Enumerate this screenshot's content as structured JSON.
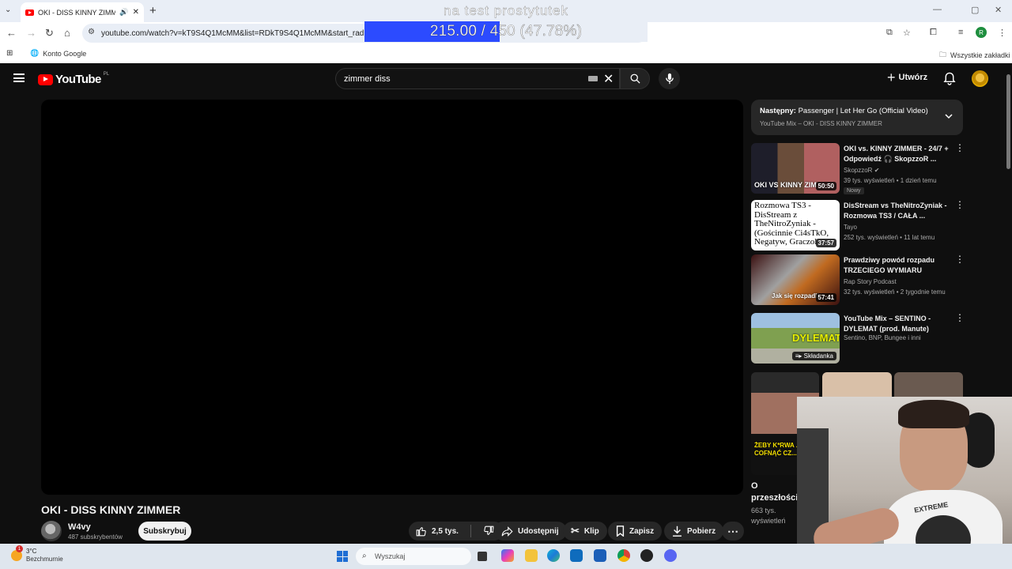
{
  "browser": {
    "tab_title": "OKI - DISS KINNY ZIMMER",
    "url": "youtube.com/watch?v=kT9S4Q1McMM&list=RDkT9S4Q1McMM&start_radio=1",
    "bookmark_google": "Konto Google",
    "bookmark_all": "Wszystkie zakładki",
    "profile_initial": "R"
  },
  "overlay": {
    "top_text": "na test prostytutek",
    "progress_text": "215.00 / 450 (47.78%)",
    "progress_fraction": 0.4778,
    "fill_color": "#2c4bff"
  },
  "youtube": {
    "logo_text": "YouTube",
    "region": "PL",
    "search_value": "zimmer diss",
    "create_label": "Utwórz",
    "video_title": "OKI - DISS KINNY ZIMMER",
    "channel_name": "W4vy",
    "channel_subs": "487 subskrybentów",
    "subscribe_label": "Subskrybuj",
    "likes": "2,5 tys.",
    "share_label": "Udostępnij",
    "clip_label": "Klip",
    "save_label": "Zapisz",
    "download_label": "Pobierz",
    "up_next_prefix": "Następny:",
    "up_next_title": "Passenger | Let Her Go (Official Video)",
    "up_next_sub": "YouTube Mix – OKI - DISS KINNY ZIMMER",
    "recommendations": [
      {
        "title": "OKI vs. KINNY ZIMMER - 24/7 + Odpowiedź 🎧 SkopzzoR ...",
        "channel": "SkopzzoR",
        "meta": "39 tys. wyświetleń • 1 dzień temu",
        "badge": "Nowy",
        "duration": "50:50",
        "thumb_caption": "OKI VS KINNY ZIM"
      },
      {
        "title": "DisStream vs TheNitroZyniak - Rozmowa TS3 / CAŁA ...",
        "channel": "Tayo",
        "meta": "252 tys. wyświetleń • 11 lat temu",
        "duration": "37:57",
        "thumb_caption": "Rozmowa TS3 - DisStream z TheNitroZyniak - (Gościnnie Ci4sTkO, Negatyw, Graczol"
      },
      {
        "title": "Prawdziwy powód rozpadu TRZECIEGO WYMIARU",
        "channel": "Rap Story Podcast",
        "meta": "32 tys. wyświetleń • 2 tygodnie temu",
        "duration": "57:41",
        "thumb_caption": "Jak się rozpadli"
      },
      {
        "title": "YouTube Mix – SENTINO - DYLEMAT (prod. Manute)",
        "channel": "Sentino, BNP, Bungee i inni",
        "mix_label": "Składanka",
        "thumb_caption": "DYLEMAT"
      }
    ],
    "shorts_caption": "ŻEBY K*RWA ... COFNĄĆ CZ...",
    "shorts_title": "O przeszłości...",
    "shorts_views": "663 tys. wyświetleń"
  },
  "webcam": {
    "shirt_text": "EXTREME"
  },
  "taskbar": {
    "temperature": "3°C",
    "weather": "Bezchmurnie",
    "search_placeholder": "Wyszukaj",
    "notif_count": "1"
  }
}
